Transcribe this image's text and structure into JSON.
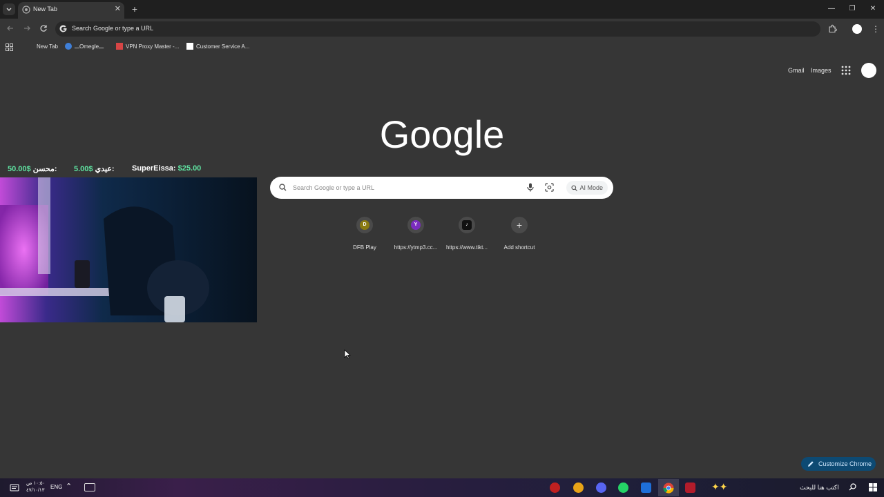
{
  "browser": {
    "tab_title": "New Tab",
    "tab_close": "✕",
    "new_tab": "+",
    "window_controls": {
      "minimize": "—",
      "restore": "❐",
      "close": "✕"
    },
    "omnibox_text": "Search Google or type a URL"
  },
  "bookmarks": [
    {
      "label": "New Tab",
      "icon": "none"
    },
    {
      "label": "ـــOmegleـــ",
      "icon": "omegle-icon"
    },
    {
      "label": "VPN Proxy Master -...",
      "icon": "vpn-icon"
    },
    {
      "label": "Customer Service A...",
      "icon": "page-icon"
    }
  ],
  "ntp": {
    "gmail": "Gmail",
    "images": "Images",
    "logo": "Google",
    "search_placeholder": "Search Google or type a URL",
    "ai_mode": "AI Mode",
    "shortcuts": [
      {
        "label": "DFB Play",
        "letter": "D",
        "color": "#8a7a12"
      },
      {
        "label": "https://ytmp3.cc...",
        "letter": "Y",
        "color": "#7b2cbf"
      },
      {
        "label": "https://www.tikt...",
        "letter": "♪",
        "color": "#111111"
      },
      {
        "label": "Add shortcut",
        "letter": "+",
        "color": "#4a4a4a"
      }
    ],
    "customize": "Customize Chrome"
  },
  "overlay": {
    "donations": [
      {
        "name": "محسن:",
        "amount": "50.00$"
      },
      {
        "name": "عيدي:",
        "amount": "5.00$"
      },
      {
        "name": "SuperEissa:",
        "amount": "$25.00"
      }
    ]
  },
  "taskbar": {
    "time": "١٠:٥٠ ص",
    "date": "٤٧/١٠/١٣",
    "lang": "ENG",
    "search_placeholder": "اكتب هنا للبحث"
  },
  "colors": {
    "accent_green": "#5fe3a1",
    "customize_bg": "#0d4a73"
  }
}
